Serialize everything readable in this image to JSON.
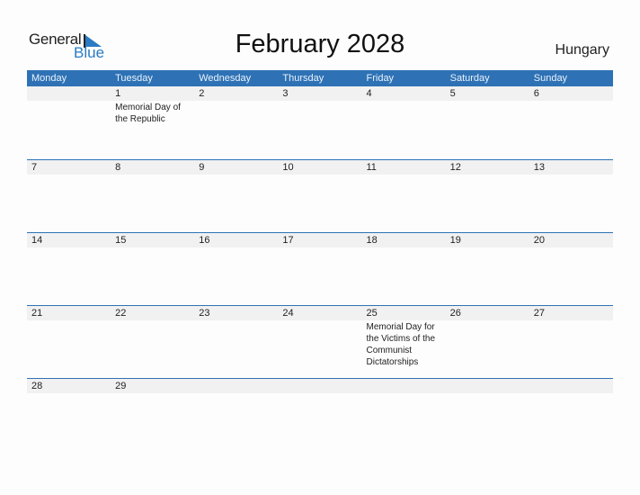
{
  "logo": {
    "word1": "General",
    "word2": "Blue"
  },
  "title": "February 2028",
  "country": "Hungary",
  "colors": {
    "header_bg": "#2e72b5",
    "strip_bg": "#f1f1f1",
    "accent": "#2a7bc4"
  },
  "weekdays": [
    "Monday",
    "Tuesday",
    "Wednesday",
    "Thursday",
    "Friday",
    "Saturday",
    "Sunday"
  ],
  "weeks": [
    [
      {
        "day": "",
        "event": ""
      },
      {
        "day": "1",
        "event": "Memorial Day of the Republic"
      },
      {
        "day": "2",
        "event": ""
      },
      {
        "day": "3",
        "event": ""
      },
      {
        "day": "4",
        "event": ""
      },
      {
        "day": "5",
        "event": ""
      },
      {
        "day": "6",
        "event": ""
      }
    ],
    [
      {
        "day": "7",
        "event": ""
      },
      {
        "day": "8",
        "event": ""
      },
      {
        "day": "9",
        "event": ""
      },
      {
        "day": "10",
        "event": ""
      },
      {
        "day": "11",
        "event": ""
      },
      {
        "day": "12",
        "event": ""
      },
      {
        "day": "13",
        "event": ""
      }
    ],
    [
      {
        "day": "14",
        "event": ""
      },
      {
        "day": "15",
        "event": ""
      },
      {
        "day": "16",
        "event": ""
      },
      {
        "day": "17",
        "event": ""
      },
      {
        "day": "18",
        "event": ""
      },
      {
        "day": "19",
        "event": ""
      },
      {
        "day": "20",
        "event": ""
      }
    ],
    [
      {
        "day": "21",
        "event": ""
      },
      {
        "day": "22",
        "event": ""
      },
      {
        "day": "23",
        "event": ""
      },
      {
        "day": "24",
        "event": ""
      },
      {
        "day": "25",
        "event": "Memorial Day for the Victims of the Communist Dictatorships"
      },
      {
        "day": "26",
        "event": ""
      },
      {
        "day": "27",
        "event": ""
      }
    ],
    [
      {
        "day": "28",
        "event": ""
      },
      {
        "day": "29",
        "event": ""
      },
      {
        "day": "",
        "event": ""
      },
      {
        "day": "",
        "event": ""
      },
      {
        "day": "",
        "event": ""
      },
      {
        "day": "",
        "event": ""
      },
      {
        "day": "",
        "event": ""
      }
    ]
  ]
}
